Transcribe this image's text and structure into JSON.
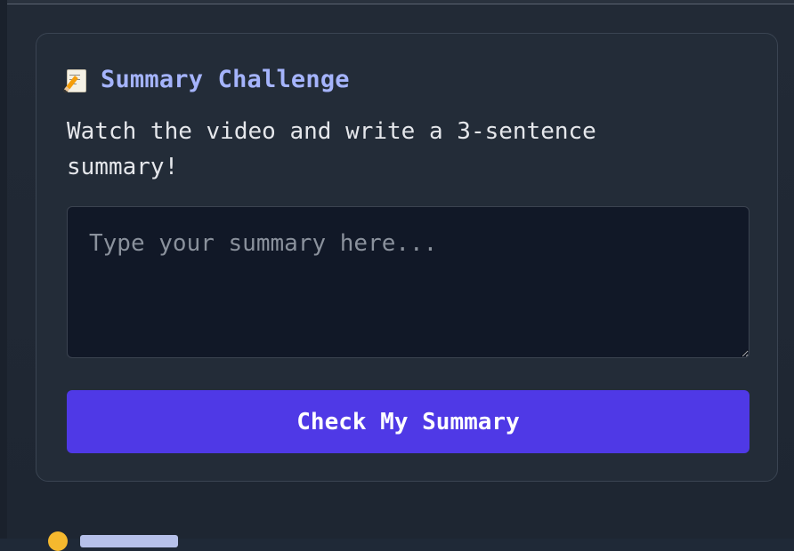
{
  "card": {
    "icon": "memo-icon",
    "title": "Summary Challenge",
    "description": "Watch the video and write a 3-sentence summary!",
    "summary_input": {
      "value": "",
      "placeholder": "Type your summary here..."
    },
    "check_button_label": "Check My Summary"
  },
  "colors": {
    "background": "#1f2937",
    "card_background": "#232c38",
    "title": "#a5b4fc",
    "button": "#4f39e6",
    "input_background": "#111827"
  }
}
